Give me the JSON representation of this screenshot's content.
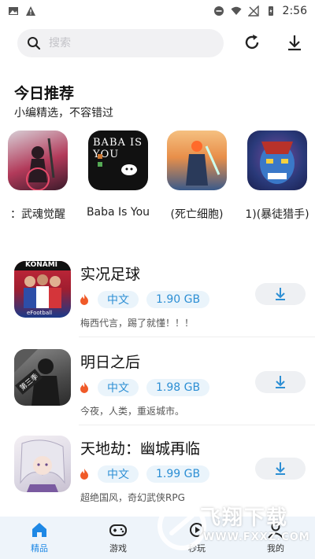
{
  "status_bar": {
    "time": "2:56"
  },
  "search": {
    "placeholder": "搜索"
  },
  "recommend": {
    "title": "今日推荐",
    "subtitle": "小编精选，不容错过",
    "items": [
      {
        "label": "：武魂觉醒"
      },
      {
        "label": "Baba Is You"
      },
      {
        "label": "(死亡细胞)"
      },
      {
        "label": "1)(暴徒猎手)"
      }
    ]
  },
  "games": [
    {
      "name": "实况足球",
      "lang": "中文",
      "size": "1.90 GB",
      "desc": "梅西代言，踢了就懂！！！",
      "icon_badge": "KONAMI",
      "icon_sub": "eFootball"
    },
    {
      "name": "明日之后",
      "lang": "中文",
      "size": "1.98 GB",
      "desc": "今夜，人类，重返城市。",
      "icon_badge": "第三季"
    },
    {
      "name": "天地劫：幽城再临",
      "lang": "中文",
      "size": "1.99 GB",
      "desc": "超绝国风，奇幻武侠RPG"
    }
  ],
  "nav": {
    "items": [
      {
        "label": "精品"
      },
      {
        "label": "游戏"
      },
      {
        "label": "秒玩"
      },
      {
        "label": "我的"
      }
    ]
  },
  "watermark": {
    "title": "飞翔下载",
    "url": "WWW.FXXZ.COM"
  },
  "colors": {
    "accent": "#2d8fd4",
    "tag_bg": "#eaf4fb",
    "nav_bg": "#eef4fa",
    "fire": "#f05a28"
  }
}
